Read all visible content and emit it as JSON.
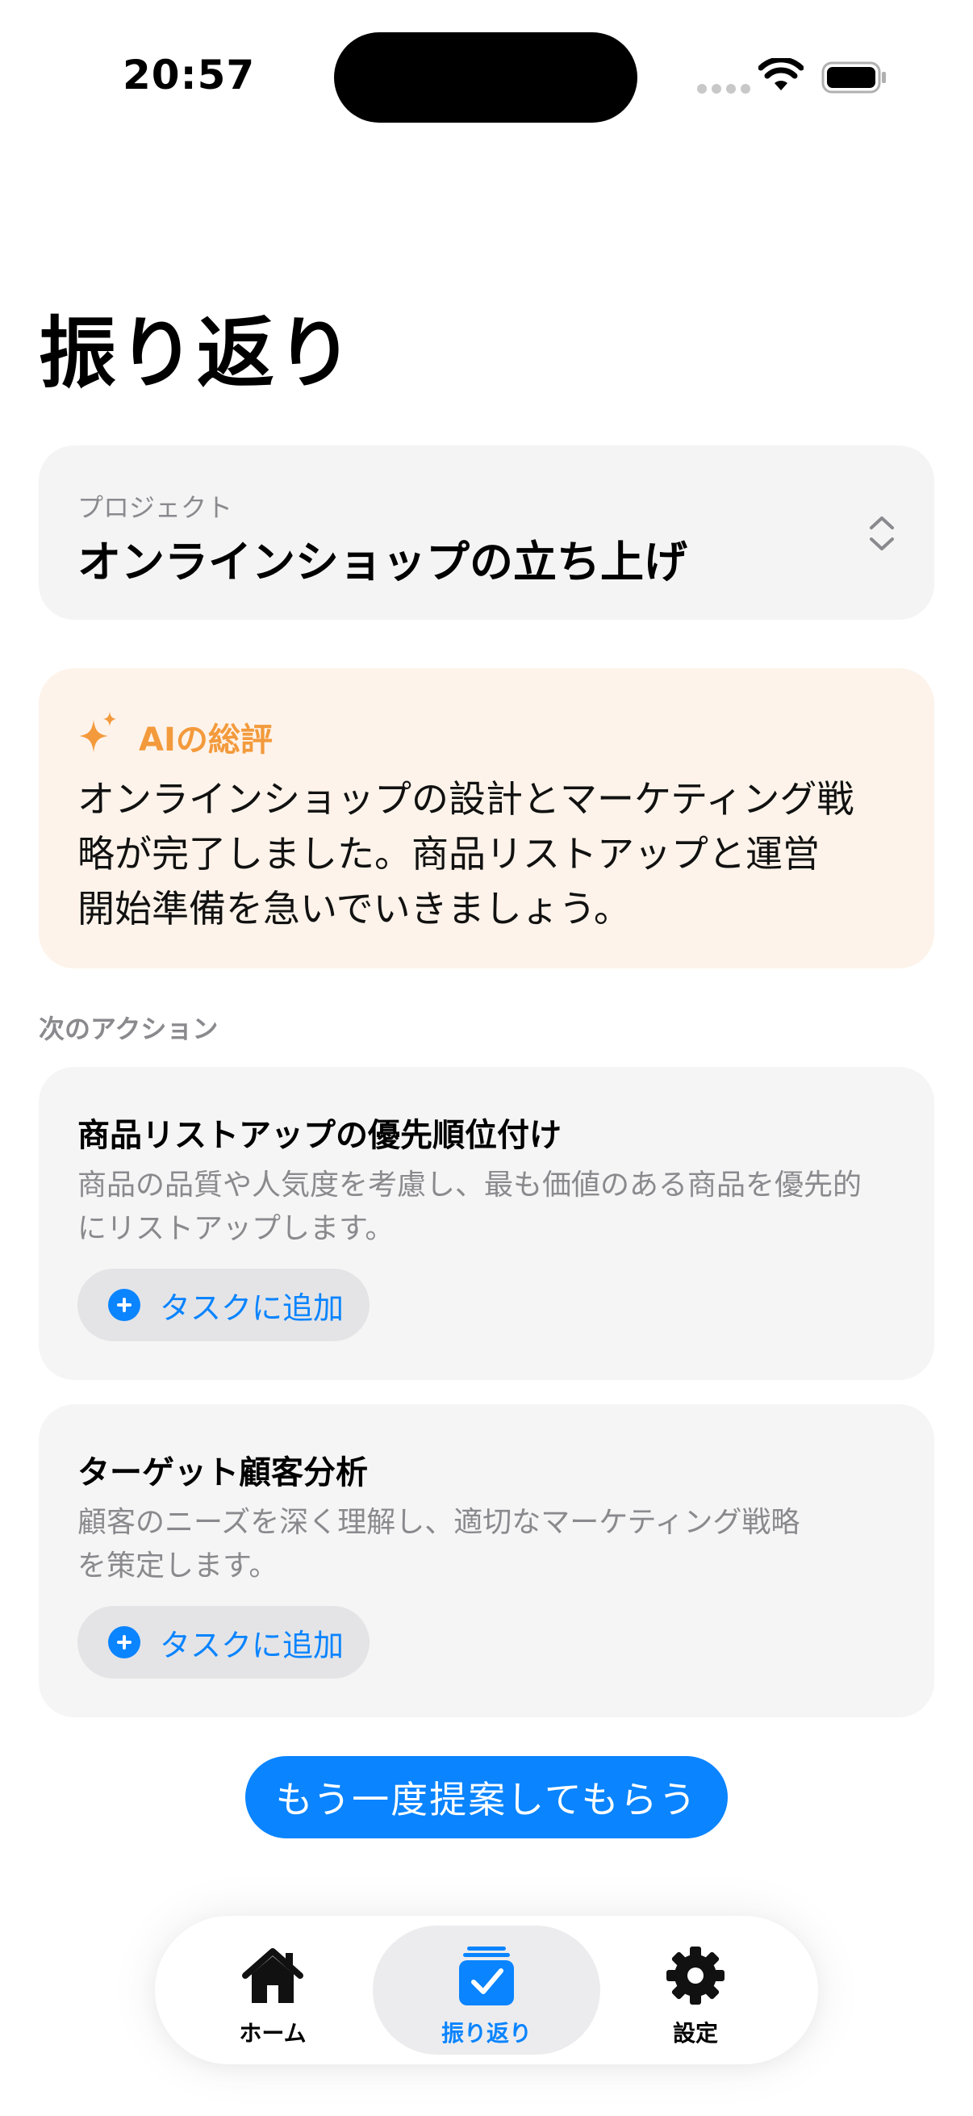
{
  "status_bar": {
    "time": "20:57"
  },
  "page": {
    "title": "振り返り"
  },
  "project": {
    "label": "プロジェクト",
    "name": "オンラインショップの立ち上げ"
  },
  "ai_summary": {
    "title": "AIの総評",
    "body_lines": [
      "オンラインショップの設計とマーケティング戦",
      "略が完了しました。商品リストアップと運営",
      "開始準備を急いでいきましょう。"
    ],
    "accent_color": "#f39a3c"
  },
  "next_actions": {
    "label": "次のアクション",
    "items": [
      {
        "title": "商品リストアップの優先順位付け",
        "desc_lines": [
          "商品の品質や人気度を考慮し、最も価値のある商品を優先的",
          "にリストアップします。"
        ],
        "button": "タスクに追加"
      },
      {
        "title": "ターゲット顧客分析",
        "desc_lines": [
          "顧客のニーズを深く理解し、適切なマーケティング戦略",
          "を策定します。"
        ],
        "button": "タスクに追加"
      }
    ]
  },
  "retry_button": {
    "label": "もう一度提案してもらう"
  },
  "tabbar": {
    "tabs": [
      {
        "label": "ホーム",
        "icon": "house-icon"
      },
      {
        "label": "振り返り",
        "icon": "checklist-icon",
        "selected": true
      },
      {
        "label": "設定",
        "icon": "gear-icon"
      }
    ]
  },
  "colors": {
    "accent_blue": "#0a84ff",
    "card_bg": "#f5f5f5",
    "ai_card_bg": "#fdf3ea"
  }
}
